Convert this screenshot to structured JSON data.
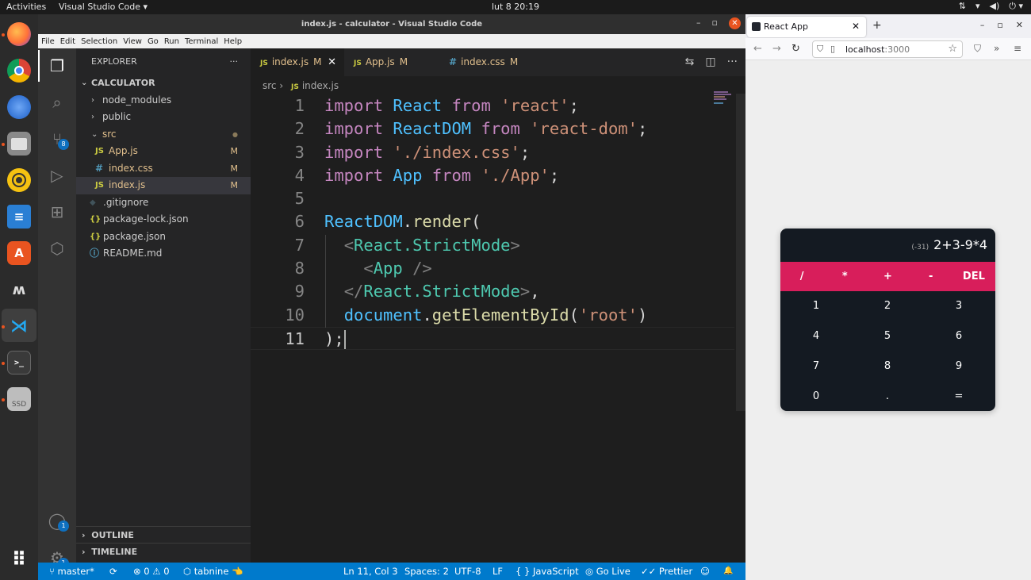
{
  "system": {
    "activities": "Activities",
    "app_menu": "Visual Studio Code ▾",
    "clock": "lut 8  20:19",
    "tray": [
      "⇅",
      "▾",
      "◀)",
      "⏻ ▾"
    ]
  },
  "dock": {
    "items": [
      "firefox",
      "chrome",
      "thunderbird",
      "files",
      "rhythmbox",
      "writer",
      "software",
      "mendeley",
      "help",
      "vscode",
      "terminal",
      "ssd"
    ],
    "ssd_label": "SSD",
    "terminal_label": ">_",
    "apps_grid_icon": "⠿"
  },
  "vscode": {
    "title": "index.js - calculator - Visual Studio Code",
    "window_buttons": [
      "–",
      "▫",
      "✕"
    ],
    "menu": [
      "File",
      "Edit",
      "Selection",
      "View",
      "Go",
      "Run",
      "Terminal",
      "Help"
    ],
    "activitybar": {
      "scm_badge": "8",
      "accounts_badge": "1",
      "settings_badge": "1"
    },
    "explorer": {
      "title": "EXPLORER",
      "more": "···",
      "root": "CALCULATOR",
      "items": [
        {
          "label": "node_modules",
          "chev": "›",
          "icon": "",
          "mod": ""
        },
        {
          "label": "public",
          "chev": "›",
          "icon": "",
          "mod": ""
        },
        {
          "label": "src",
          "chev": "⌄",
          "icon": "",
          "mod": "●"
        },
        {
          "label": "App.js",
          "chev": "",
          "icon": "JS",
          "mod": "M"
        },
        {
          "label": "index.css",
          "chev": "",
          "icon": "#",
          "mod": "M"
        },
        {
          "label": "index.js",
          "chev": "",
          "icon": "JS",
          "mod": "M"
        },
        {
          "label": ".gitignore",
          "chev": "",
          "icon": "◆",
          "mod": ""
        },
        {
          "label": "package-lock.json",
          "chev": "",
          "icon": "{}",
          "mod": ""
        },
        {
          "label": "package.json",
          "chev": "",
          "icon": "{}",
          "mod": ""
        },
        {
          "label": "README.md",
          "chev": "",
          "icon": "ⓘ",
          "mod": ""
        }
      ],
      "outline": "OUTLINE",
      "timeline": "TIMELINE"
    },
    "tabs": [
      {
        "icon": "JS",
        "label": "index.js",
        "mod": "M",
        "close": "✕"
      },
      {
        "icon": "JS",
        "label": "App.js",
        "mod": "M"
      },
      {
        "icon": "#",
        "label": "index.css",
        "mod": "M"
      }
    ],
    "editor_actions": [
      "⇆",
      "◫",
      "···"
    ],
    "breadcrumb": {
      "folder": "src",
      "sep": "›",
      "icon": "JS",
      "file": "index.js"
    },
    "code_lines": [
      {
        "n": "1",
        "tokens": [
          [
            "k",
            "import"
          ],
          [
            "p",
            " "
          ],
          [
            "v",
            "React"
          ],
          [
            "p",
            " "
          ],
          [
            "k",
            "from"
          ],
          [
            "p",
            " "
          ],
          [
            "s",
            "'react'"
          ],
          [
            "p",
            ";"
          ]
        ]
      },
      {
        "n": "2",
        "tokens": [
          [
            "k",
            "import"
          ],
          [
            "p",
            " "
          ],
          [
            "v",
            "ReactDOM"
          ],
          [
            "p",
            " "
          ],
          [
            "k",
            "from"
          ],
          [
            "p",
            " "
          ],
          [
            "s",
            "'react-dom'"
          ],
          [
            "p",
            ";"
          ]
        ]
      },
      {
        "n": "3",
        "tokens": [
          [
            "k",
            "import"
          ],
          [
            "p",
            " "
          ],
          [
            "s",
            "'./index.css'"
          ],
          [
            "p",
            ";"
          ]
        ]
      },
      {
        "n": "4",
        "tokens": [
          [
            "k",
            "import"
          ],
          [
            "p",
            " "
          ],
          [
            "v",
            "App"
          ],
          [
            "p",
            " "
          ],
          [
            "k",
            "from"
          ],
          [
            "p",
            " "
          ],
          [
            "s",
            "'./App'"
          ],
          [
            "p",
            ";"
          ]
        ]
      },
      {
        "n": "5",
        "tokens": []
      },
      {
        "n": "6",
        "tokens": [
          [
            "v",
            "ReactDOM"
          ],
          [
            "p",
            "."
          ],
          [
            "f",
            "render"
          ],
          [
            "p",
            "("
          ]
        ]
      },
      {
        "n": "7",
        "tokens": [
          [
            "p",
            "  "
          ],
          [
            "g",
            "<"
          ],
          [
            "t",
            "React.StrictMode"
          ],
          [
            "g",
            ">"
          ]
        ]
      },
      {
        "n": "8",
        "tokens": [
          [
            "p",
            "    "
          ],
          [
            "g",
            "<"
          ],
          [
            "t",
            "App"
          ],
          [
            "p",
            " "
          ],
          [
            "g",
            "/>"
          ]
        ]
      },
      {
        "n": "9",
        "tokens": [
          [
            "p",
            "  "
          ],
          [
            "g",
            "</"
          ],
          [
            "t",
            "React.StrictMode"
          ],
          [
            "g",
            ">"
          ],
          [
            "p",
            ","
          ]
        ]
      },
      {
        "n": "10",
        "tokens": [
          [
            "p",
            "  "
          ],
          [
            "v",
            "document"
          ],
          [
            "p",
            "."
          ],
          [
            "f",
            "getElementById"
          ],
          [
            "p",
            "("
          ],
          [
            "s",
            "'root'"
          ],
          [
            "p",
            ")"
          ]
        ]
      },
      {
        "n": "11",
        "tokens": [
          [
            "p",
            ");"
          ]
        ]
      }
    ],
    "status": {
      "branch": "⑂ master*",
      "sync": "⟳",
      "problems": "⊗ 0 ⚠ 0",
      "tabnine": "⬡ tabnine 👈",
      "position": "Ln 11, Col 3",
      "spaces": "Spaces: 2",
      "encoding": "UTF-8",
      "eol": "LF",
      "language": "{ }  JavaScript",
      "golive": "◎ Go Live",
      "prettier": "✓✓ Prettier",
      "feedback": "☺",
      "bell": "🔔"
    }
  },
  "firefox": {
    "tab_title": "React App",
    "tab_close": "✕",
    "new_tab": "+",
    "window_buttons": [
      "–",
      "▫",
      "✕"
    ],
    "nav": [
      "←",
      "→",
      "↻"
    ],
    "url_host": "localhost",
    "url_port": ":3000",
    "right_icons": [
      "⛉",
      "»",
      "≡"
    ]
  },
  "calculator": {
    "result": "(-31)",
    "expression": "2+3-9*4",
    "operators": [
      "/",
      "*",
      "+",
      "-",
      "DEL"
    ],
    "digits": [
      "1",
      "2",
      "3",
      "4",
      "5",
      "6",
      "7",
      "8",
      "9",
      "0",
      ".",
      "="
    ],
    "colors": {
      "accent": "#d81e5b",
      "panel": "#141a22"
    }
  }
}
